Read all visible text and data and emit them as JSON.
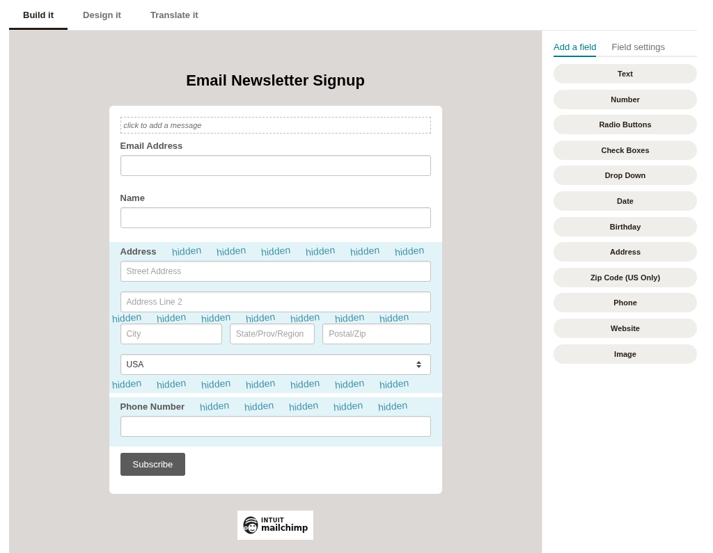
{
  "tabs": [
    {
      "label": "Build it",
      "selected": true
    },
    {
      "label": "Design it",
      "selected": false
    },
    {
      "label": "Translate it",
      "selected": false
    }
  ],
  "form": {
    "title": "Email Newsletter Signup",
    "message_prompt": "click to add a message",
    "fields": [
      {
        "kind": "text",
        "label": "Email Address",
        "hidden": false
      },
      {
        "kind": "text",
        "label": "Name",
        "hidden": false
      },
      {
        "kind": "address",
        "label": "Address",
        "hidden": true,
        "label_watermarks": [
          "hidden",
          "hidden",
          "hidden",
          "hidden",
          "hidden",
          "hidden"
        ],
        "rows": [
          {
            "inputs": [
              {
                "placeholder": "Street Address"
              }
            ]
          },
          {
            "inputs": [
              {
                "placeholder": "Address Line 2"
              }
            ],
            "watermarks": [
              "hidden",
              "hidden",
              "hidden",
              "hidden",
              "hidden",
              "hidden",
              "hidden"
            ]
          },
          {
            "inputs": [
              {
                "placeholder": "City"
              },
              {
                "placeholder": "State/Prov/Region"
              },
              {
                "placeholder": "Postal/Zip"
              }
            ]
          }
        ],
        "country": {
          "value": "USA",
          "watermarks": [
            "hidden",
            "hidden",
            "hidden",
            "hidden",
            "hidden",
            "hidden",
            "hidden"
          ]
        }
      },
      {
        "kind": "text",
        "label": "Phone Number",
        "hidden": true,
        "label_watermarks": [
          "hidden",
          "hidden",
          "hidden",
          "hidden",
          "hidden"
        ]
      }
    ],
    "submit_label": "Subscribe"
  },
  "footer_badge": {
    "brand_top": "INTUIT",
    "brand_name": "mailchimp"
  },
  "panel": {
    "tabs": [
      {
        "label": "Add a field",
        "selected": true
      },
      {
        "label": "Field settings",
        "selected": false
      }
    ],
    "field_types": [
      "Text",
      "Number",
      "Radio Buttons",
      "Check Boxes",
      "Drop Down",
      "Date",
      "Birthday",
      "Address",
      "Zip Code (US Only)",
      "Phone",
      "Website",
      "Image"
    ]
  }
}
